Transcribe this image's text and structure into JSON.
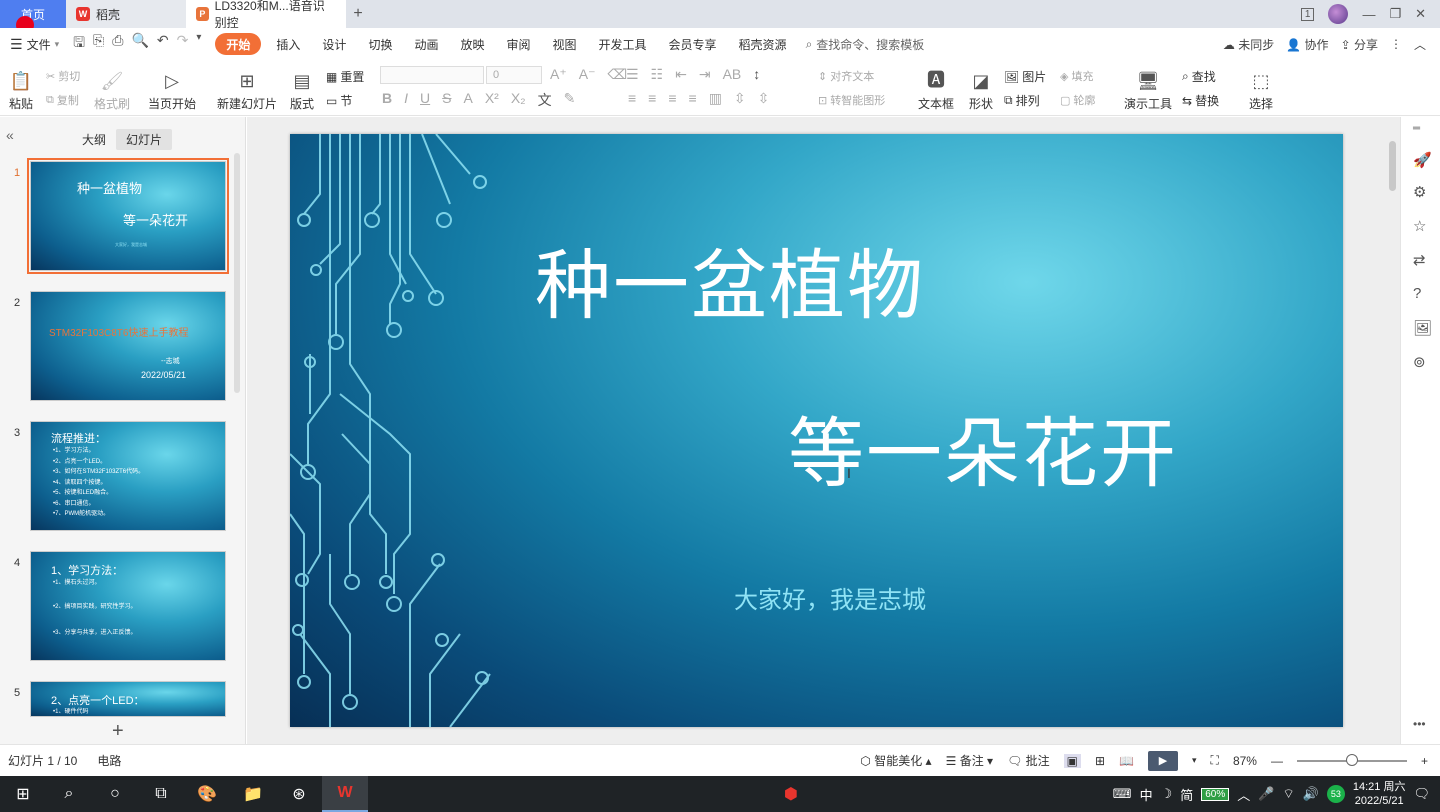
{
  "tabbar": {
    "home": "首页",
    "tabs": [
      {
        "label": "稻壳"
      },
      {
        "label": "LD3320和M...语音识别控"
      }
    ],
    "window_badge": "1"
  },
  "menu": {
    "file": "文件",
    "items": [
      "开始",
      "插入",
      "设计",
      "切换",
      "动画",
      "放映",
      "审阅",
      "视图",
      "开发工具",
      "会员专享",
      "稻壳资源"
    ],
    "search_placeholder": "查找命令、搜索模板",
    "right": [
      "未同步",
      "协作",
      "分享"
    ]
  },
  "ribbon": {
    "paste": "粘贴",
    "cut": "剪切",
    "copy": "复制",
    "format_painter": "格式刷",
    "from_current": "当页开始",
    "new_slide": "新建幻灯片",
    "layout": "版式",
    "reset": "重置",
    "section": "节",
    "font_size": "0",
    "align_text": "对齐文本",
    "smartart": "转智能图形",
    "textbox": "文本框",
    "shape": "形状",
    "picture": "图片",
    "arrange": "排列",
    "fill": "填充",
    "outline": "轮廓",
    "present_tools": "演示工具",
    "find": "查找",
    "replace": "替换",
    "select": "选择"
  },
  "panel": {
    "tabs": [
      "大纲",
      "幻灯片"
    ],
    "slides": [
      {
        "num": "1",
        "title": "种一盆植物",
        "subtitle": "等一朵花开",
        "small": "大家好，我是志城"
      },
      {
        "num": "2",
        "title": "STM32F103C8T6快速上手教程",
        "author": "--志城",
        "date": "2022/05/21"
      },
      {
        "num": "3",
        "title": "流程推进：",
        "lines": [
          "•1、学习方法。",
          "•2、点亮一个LED。",
          "•3、如何在STM32F103ZT6代码。",
          "•4、读取四个按键。",
          "•5、按键和LED融合。",
          "•6、串口通信。",
          "•7、PWM舵机驱动。"
        ]
      },
      {
        "num": "4",
        "title": "1、学习方法：",
        "lines": [
          "•1、摸石头过河。",
          "•2、搞项目实践，研究性学习。",
          "•3、分享与共享，进入正反馈。"
        ]
      },
      {
        "num": "5",
        "title": "2、点亮一个LED：",
        "lines": [
          "•1、硬件代码"
        ]
      }
    ]
  },
  "slide": {
    "title": "种一盆植物",
    "subtitle": "等一朵花开",
    "greeting": "大家好，我是志城"
  },
  "status": {
    "slide_count": "幻灯片 1 / 10",
    "theme": "电路",
    "beautify": "智能美化",
    "notes": "备注",
    "comments": "批注",
    "zoom": "87%",
    "zoom_fraction": 0.5
  },
  "taskbar": {
    "ime": "中",
    "ime2": "简",
    "battery": "60%",
    "notif_count": "53",
    "time": "14:21 周六",
    "date": "2022/5/21",
    "notif_badge": "1"
  },
  "colors": {
    "accent": "#f26f36",
    "home_tab": "#4f7ef0",
    "slide_text": "#ffffff",
    "slide_small_text": "#8fe3f5"
  }
}
